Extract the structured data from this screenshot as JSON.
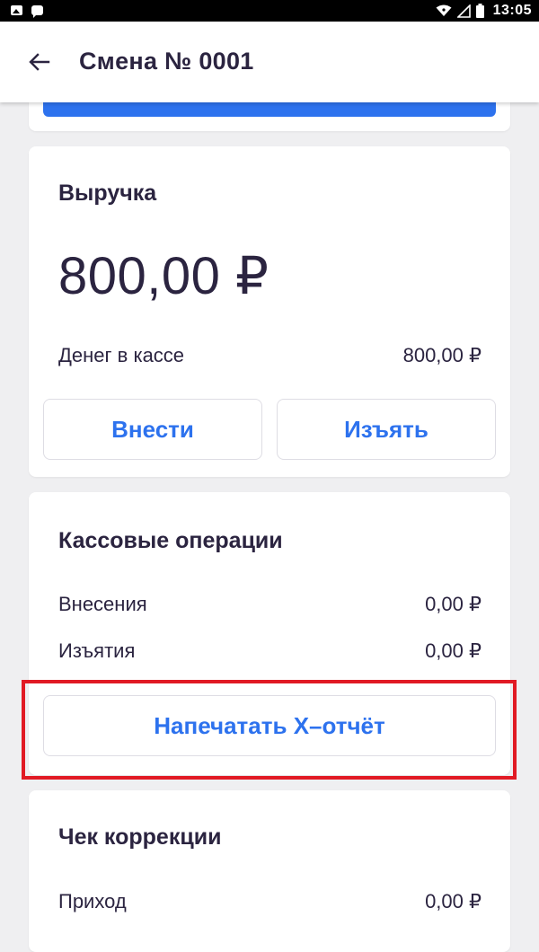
{
  "status_bar": {
    "time": "13:05",
    "icons": [
      "image-icon",
      "message-icon",
      "wifi-icon",
      "signal-icon",
      "battery-icon"
    ]
  },
  "app_bar": {
    "back_icon": "arrow-left-icon",
    "title": "Смена № 0001"
  },
  "revenue": {
    "title": "Выручка",
    "amount": "800,00 ₽",
    "cash_label": "Денег в кассе",
    "cash_value": "800,00 ₽",
    "deposit_button": "Внести",
    "withdraw_button": "Изъять"
  },
  "operations": {
    "title": "Кассовые операции",
    "rows": [
      {
        "label": "Внесения",
        "value": "0,00 ₽"
      },
      {
        "label": "Изъятия",
        "value": "0,00 ₽"
      }
    ],
    "print_button": "Напечатать X–отчёт"
  },
  "correction": {
    "title": "Чек коррекции",
    "rows": [
      {
        "label": "Приход",
        "value": "0,00 ₽"
      }
    ]
  },
  "colors": {
    "accent": "#2d72ee",
    "text": "#2b2440",
    "background": "#efeff1",
    "highlight": "#e11a24"
  }
}
